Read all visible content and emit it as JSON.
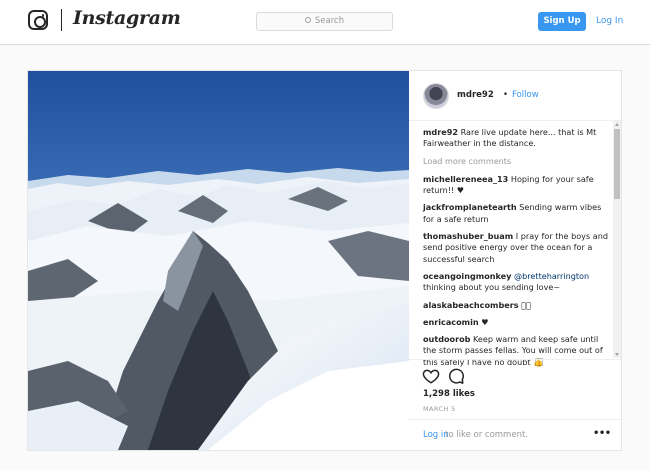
{
  "header": {
    "wordmark": "Instagram",
    "search_placeholder": "Search",
    "signup_label": "Sign Up",
    "login_label": "Log In"
  },
  "post": {
    "username": "mdre92",
    "separator": "•",
    "follow_label": "Follow",
    "caption": {
      "user": "mdre92",
      "text": "Rare live update here... that is Mt Fairweather in the distance."
    },
    "load_more": "Load more comments",
    "comments": [
      {
        "user": "michellereneea_13",
        "text": "Hoping for your safe return!! ♥"
      },
      {
        "user": "jackfromplanetearth",
        "text": "Sending warm vibes for a safe return"
      },
      {
        "user": "thomashuber_buam",
        "text": "I pray for the boys and send positive energy over the ocean for a successful search"
      },
      {
        "user": "oceangoingmonkey",
        "mention": "@bretteharrington",
        "text": "thinking about you sending love~"
      },
      {
        "user": "alaskabeachcombers",
        "text": "⃞⃞"
      },
      {
        "user": "enricacomin",
        "text": "♥"
      },
      {
        "user": "outdoorob",
        "text": "Keep warm and keep safe until the storm passes fellas. You will come out of this safely I have no doubt 👍⃞"
      }
    ],
    "likes": "1,298 likes",
    "date": "MARCH 5",
    "footer_login": "Log in",
    "footer_text": "to like or comment.",
    "more_label": "•••"
  },
  "colors": {
    "accent": "#3897f0",
    "text": "#262626",
    "muted": "#999999",
    "border": "#dbdbdb"
  },
  "icons": [
    "instagram-camera-icon",
    "search-icon",
    "heart-icon",
    "comment-icon",
    "more-options-icon"
  ]
}
